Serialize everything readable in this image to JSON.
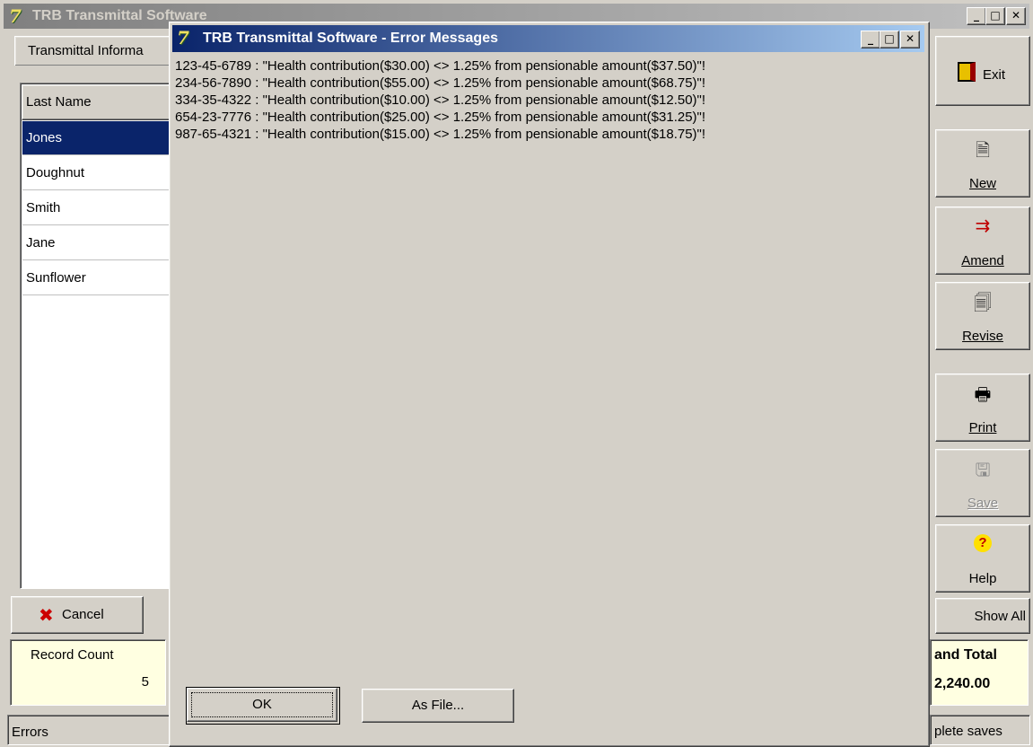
{
  "main_window": {
    "title": "TRB Transmittal Software",
    "tab": "Transmittal Informa",
    "column_header": "Last Name",
    "rows": [
      "Jones",
      "Doughnut",
      "Smith",
      "Jane",
      "Sunflower"
    ],
    "cancel_label": "Cancel",
    "record_count_label": "Record Count",
    "record_count_value": "5",
    "grand_total_label": "and Total",
    "grand_total_value": "2,240.00",
    "status_left": "Errors",
    "status_right": "plete saves"
  },
  "side_buttons": {
    "exit": "Exit",
    "new": "New",
    "amend": "Amend",
    "revise": "Revise",
    "print": "Print",
    "save": "Save",
    "help": "Help",
    "show_all": "Show All"
  },
  "dialog": {
    "title": "TRB Transmittal Software - Error Messages",
    "messages": [
      "123-45-6789 : \"Health contribution($30.00) <> 1.25% from pensionable amount($37.50)\"!",
      "234-56-7890 : \"Health contribution($55.00) <> 1.25% from pensionable amount($68.75)\"!",
      "334-35-4322 : \"Health contribution($10.00) <> 1.25% from pensionable amount($12.50)\"!",
      "654-23-7776 : \"Health contribution($25.00) <> 1.25% from pensionable amount($31.25)\"!",
      "987-65-4321 : \"Health contribution($15.00) <> 1.25% from pensionable amount($18.75)\"!"
    ],
    "ok_label": "OK",
    "as_file_label": "As File..."
  },
  "caption_buttons": {
    "minimize": "_",
    "maximize": "□",
    "close": "✕"
  },
  "icons": {
    "app_logo": "7",
    "exit_icon": "door-exit-icon",
    "new_icon": "new-document-icon",
    "amend_icon": "amend-icon",
    "revise_icon": "revise-icon",
    "print_icon": "printer-icon",
    "save_icon": "floppy-disk-icon",
    "help_icon": "help-icon",
    "cancel_icon": "red-x-icon"
  },
  "colors": {
    "selection": "#0a246a",
    "panel_yellow": "#ffffe1",
    "title_gradient_start": "#0a246a",
    "title_gradient_end": "#a6caf0"
  }
}
